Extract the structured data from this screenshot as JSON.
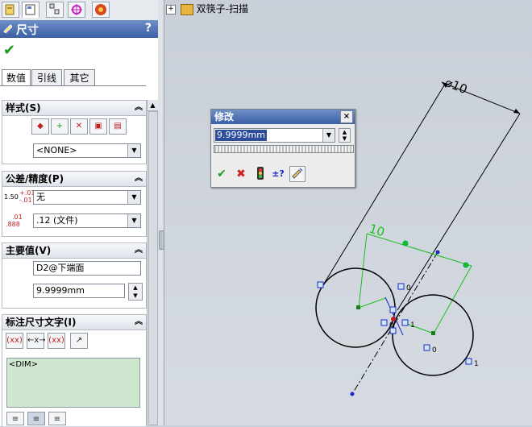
{
  "tree": {
    "expander": "+",
    "item": "双筷子-扫描"
  },
  "pm": {
    "title": "尺寸",
    "help": "?"
  },
  "tabs": [
    "数值",
    "引线",
    "其它"
  ],
  "style": {
    "header": "样式(S)",
    "select": "<NONE>"
  },
  "tolerance": {
    "header": "公差/精度(P)",
    "tol_value": "无",
    "precision_value": ".12 (文件)",
    "tol_icon_main": "1.50",
    "tol_icon_top": "+.01",
    "tol_icon_bottom": "-.01",
    "prec_icon_top": ".01",
    "prec_icon_bottom": ".888"
  },
  "primary": {
    "header": "主要值(V)",
    "name": "D2@下端面",
    "value": "9.9999mm"
  },
  "dimtext": {
    "header": "标注尺寸文字(I)",
    "content": "<DIM>",
    "btn1": "(xx)",
    "btn2": "←x→",
    "btn3": "(xx)"
  },
  "dialog": {
    "title": "修改",
    "close": "×",
    "value": "9.9999mm",
    "ok": "✔",
    "cancel": "✖",
    "help": "±?"
  },
  "drawing": {
    "dim_top": "⌀10",
    "dim_green": "10",
    "label_0": "0",
    "label_1": "1"
  },
  "colors": {
    "title_bar": "#3b5fa6",
    "green_dim": "#1bbf1b",
    "point_blue": "#1a27c7"
  }
}
